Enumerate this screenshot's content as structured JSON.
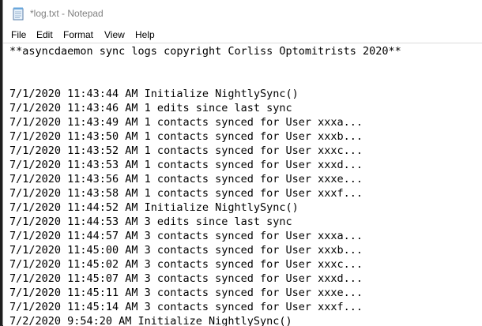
{
  "window": {
    "title": "*log.txt - Notepad"
  },
  "menu": [
    "File",
    "Edit",
    "Format",
    "View",
    "Help"
  ],
  "document": {
    "lines": [
      "**asyncdaemon sync logs copyright Corliss Optomitrists 2020**",
      "",
      "",
      "7/1/2020 11:43:44 AM Initialize NightlySync()",
      "7/1/2020 11:43:46 AM 1 edits since last sync",
      "7/1/2020 11:43:49 AM 1 contacts synced for User xxxa...",
      "7/1/2020 11:43:50 AM 1 contacts synced for User xxxb...",
      "7/1/2020 11:43:52 AM 1 contacts synced for User xxxc...",
      "7/1/2020 11:43:53 AM 1 contacts synced for User xxxd...",
      "7/1/2020 11:43:56 AM 1 contacts synced for User xxxe...",
      "7/1/2020 11:43:58 AM 1 contacts synced for User xxxf...",
      "7/1/2020 11:44:52 AM Initialize NightlySync()",
      "7/1/2020 11:44:53 AM 3 edits since last sync",
      "7/1/2020 11:44:57 AM 3 contacts synced for User xxxa...",
      "7/1/2020 11:45:00 AM 3 contacts synced for User xxxb...",
      "7/1/2020 11:45:02 AM 3 contacts synced for User xxxc...",
      "7/1/2020 11:45:07 AM 3 contacts synced for User xxxd...",
      "7/1/2020 11:45:11 AM 3 contacts synced for User xxxe...",
      "7/1/2020 11:45:14 AM 3 contacts synced for User xxxf...",
      "7/2/2020 9:54:20 AM Initialize NightlySync()"
    ]
  },
  "icons": {
    "app": "notepad-icon"
  }
}
